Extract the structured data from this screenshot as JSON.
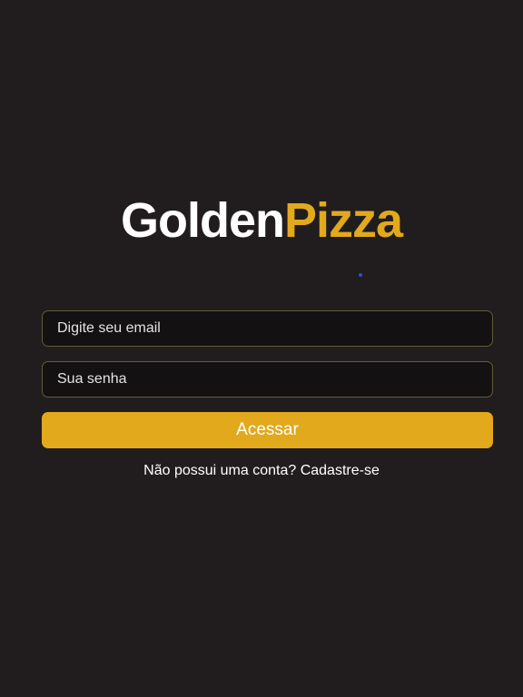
{
  "brand": {
    "part1": "Golden",
    "part2": "Pizza"
  },
  "form": {
    "email_placeholder": "Digite seu email",
    "password_placeholder": "Sua senha",
    "submit_label": "Acessar"
  },
  "signup": {
    "prompt": "Não possui uma conta?",
    "link_label": "Cadastre-se"
  },
  "colors": {
    "background": "#211d1e",
    "accent": "#e2a91d",
    "input_background": "#141112",
    "input_border": "#5f5d3a"
  }
}
